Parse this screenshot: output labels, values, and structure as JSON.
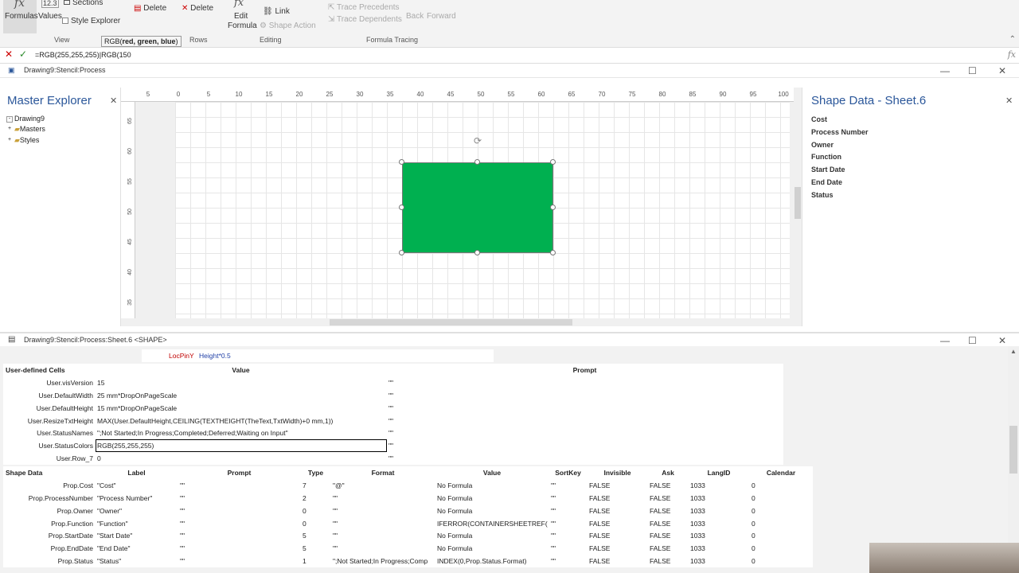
{
  "ribbon": {
    "formulas_label": "Formulas",
    "values_label": "Values",
    "sections_label": "Sections",
    "style_explorer_label": "Style Explorer",
    "delete1_label": "Delete",
    "delete2_label": "Delete",
    "edit_formula_label": "Edit",
    "edit_formula_label2": "Formula",
    "link_label": "Link",
    "shape_action_label": "Shape Action",
    "trace_precedents_label": "Trace Precedents",
    "trace_dependents_label": "Trace Dependents",
    "back_label": "Back",
    "forward_label": "Forward",
    "num_label": "12.3",
    "groups": {
      "view": "View",
      "rows": "Rows",
      "editing": "Editing",
      "formula_tracing": "Formula Tracing"
    },
    "tooltip_fn": "RGB(",
    "tooltip_args": "red, green, blue",
    ")": ")"
  },
  "formula_bar": {
    "value": "=RGB(255,255,255)|RGB(150"
  },
  "drawing_window": {
    "title": "Drawing9:Stencil:Process"
  },
  "master_explorer": {
    "title": "Master Explorer",
    "items": [
      "Drawing9",
      "Masters",
      "Styles"
    ]
  },
  "ruler": {
    "h": [
      "5",
      "0",
      "5",
      "10",
      "15",
      "20",
      "25",
      "30",
      "35",
      "40",
      "45",
      "50",
      "55",
      "60",
      "65",
      "70",
      "75",
      "80",
      "85",
      "90",
      "95",
      "100"
    ],
    "v": [
      "65",
      "60",
      "55",
      "50",
      "45",
      "40",
      "35"
    ]
  },
  "shape": {
    "fill": "#00b050"
  },
  "shape_data_panel": {
    "title": "Shape Data - Sheet.6",
    "fields": [
      "Cost",
      "Process Number",
      "Owner",
      "Function",
      "Start Date",
      "End Date",
      "Status"
    ]
  },
  "shapesheet_window": {
    "title": "Drawing9:Stencil:Process:Sheet.6 <SHAPE>"
  },
  "locpin": {
    "name": "LocPinY",
    "value": "Height*0.5"
  },
  "user_cells": {
    "header": "User-defined Cells",
    "col_value": "Value",
    "col_prompt": "Prompt",
    "rows": [
      {
        "name": "User.visVersion",
        "value": "15",
        "prompt": "\"\""
      },
      {
        "name": "User.DefaultWidth",
        "value": "25 mm*DropOnPageScale",
        "prompt": "\"\""
      },
      {
        "name": "User.DefaultHeight",
        "value": "15 mm*DropOnPageScale",
        "prompt": "\"\""
      },
      {
        "name": "User.ResizeTxtHeight",
        "value": "MAX(User.DefaultHeight,CEILING(TEXTHEIGHT(TheText,TxtWidth)+0 mm,1))",
        "prompt": "\"\""
      },
      {
        "name": "User.StatusNames",
        "value": "\";Not Started;In Progress;Completed;Deferred;Waiting on Input\"",
        "prompt": "\"\""
      },
      {
        "name": "User.StatusColors",
        "value": "RGB(255,255,255)",
        "prompt": "\"\""
      },
      {
        "name": "User.Row_7",
        "value": "0",
        "prompt": "\"\""
      }
    ]
  },
  "shape_data_table": {
    "headers": [
      "Shape Data",
      "Label",
      "Prompt",
      "Type",
      "Format",
      "Value",
      "SortKey",
      "Invisible",
      "Ask",
      "LangID",
      "Calendar"
    ],
    "rows": [
      [
        "Prop.Cost",
        "\"Cost\"",
        "\"\"",
        "7",
        "\"@\"",
        "No Formula",
        "\"\"",
        "FALSE",
        "FALSE",
        "1033",
        "0"
      ],
      [
        "Prop.ProcessNumber",
        "\"Process Number\"",
        "\"\"",
        "2",
        "\"\"",
        "No Formula",
        "\"\"",
        "FALSE",
        "FALSE",
        "1033",
        "0"
      ],
      [
        "Prop.Owner",
        "\"Owner\"",
        "\"\"",
        "0",
        "\"\"",
        "No Formula",
        "\"\"",
        "FALSE",
        "FALSE",
        "1033",
        "0"
      ],
      [
        "Prop.Function",
        "\"Function\"",
        "\"\"",
        "0",
        "\"\"",
        "IFERROR(CONTAINERSHEETREF(",
        "\"\"",
        "FALSE",
        "FALSE",
        "1033",
        "0"
      ],
      [
        "Prop.StartDate",
        "\"Start Date\"",
        "\"\"",
        "5",
        "\"\"",
        "No Formula",
        "\"\"",
        "FALSE",
        "FALSE",
        "1033",
        "0"
      ],
      [
        "Prop.EndDate",
        "\"End Date\"",
        "\"\"",
        "5",
        "\"\"",
        "No Formula",
        "\"\"",
        "FALSE",
        "FALSE",
        "1033",
        "0"
      ],
      [
        "Prop.Status",
        "\"Status\"",
        "\"\"",
        "1",
        "\";Not Started;In Progress;Comp",
        "INDEX(0,Prop.Status.Format)",
        "\"\"",
        "FALSE",
        "FALSE",
        "1033",
        "0"
      ]
    ]
  }
}
